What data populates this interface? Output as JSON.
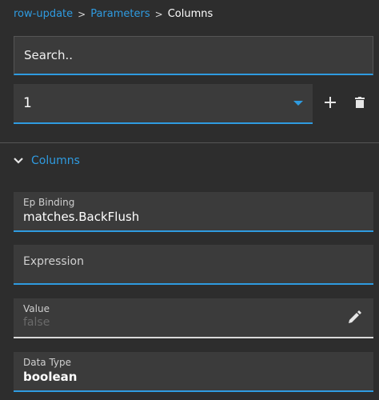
{
  "breadcrumb": {
    "items": [
      {
        "label": "row-update"
      },
      {
        "label": "Parameters"
      }
    ],
    "separator": ">",
    "current": "Columns"
  },
  "search": {
    "placeholder": "Search..",
    "value": ""
  },
  "row_select": {
    "selected": "1"
  },
  "icons": {
    "add": "plus-icon",
    "delete": "trash-icon",
    "edit": "pencil-icon",
    "collapse": "chevron-down-icon"
  },
  "section": {
    "label": "Columns"
  },
  "fields": {
    "ep_binding": {
      "label": "Ep Binding",
      "value": "matches.BackFlush"
    },
    "expression": {
      "label": "Expression",
      "value": ""
    },
    "value": {
      "label": "Value",
      "value": "false"
    },
    "data_type": {
      "label": "Data Type",
      "value": "boolean"
    }
  },
  "colors": {
    "accent": "#2f9be0",
    "background": "#2d2d2d",
    "field_bg": "#3b3b3b"
  }
}
